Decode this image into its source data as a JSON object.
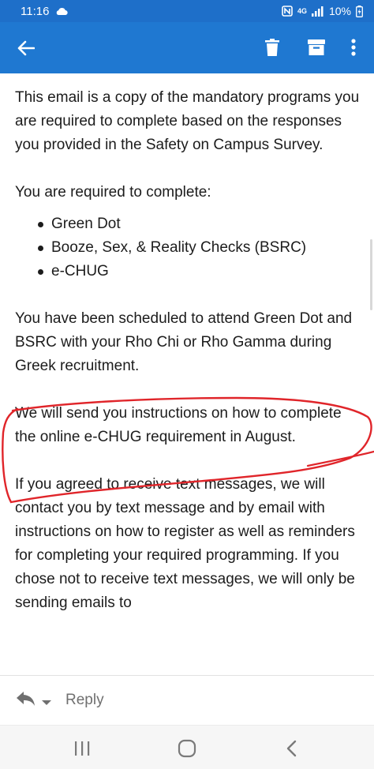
{
  "status_bar": {
    "time": "11:16",
    "network": "4G",
    "battery": "10%"
  },
  "toolbar": {
    "back_icon": "arrow-left-icon",
    "delete_icon": "trash-icon",
    "archive_icon": "archive-icon",
    "more_icon": "more-vert-icon"
  },
  "email": {
    "intro": "This email is a copy of the mandatory programs you are required to complete based on the responses you provided in the Safety on Campus Survey.",
    "required_heading": "You are required to complete:",
    "programs": [
      "Green Dot",
      "Booze, Sex, & Reality Checks (BSRC)",
      "e-CHUG"
    ],
    "scheduled": "You have been scheduled to attend Green Dot and BSRC with your Rho Chi or Rho Gamma during Greek recruitment.",
    "instructions": "We will send you instructions on how to complete the online e-CHUG requirement in August.",
    "text_messages": "If you agreed to receive text messages, we will contact you by text message and by email with instructions on how to register as well as reminders for completing your required programming. If you chose not to receive text messages, we will only be sending emails to"
  },
  "reply_bar": {
    "label": "Reply"
  },
  "colors": {
    "app_bar": "#1f78d1",
    "status_bar": "#1e6fc9",
    "annotation": "#e0252a"
  }
}
